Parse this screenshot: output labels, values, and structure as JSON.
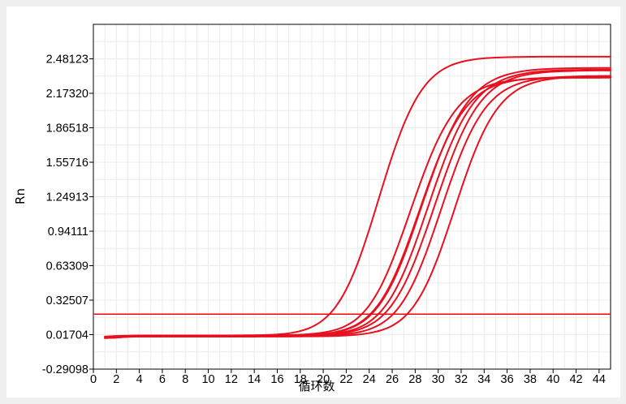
{
  "chart_data": {
    "type": "line",
    "title": "",
    "xlabel": "循环数",
    "ylabel": "Rn",
    "xlim": [
      0,
      45
    ],
    "ylim": [
      -0.29098,
      2.78925
    ],
    "grid": true,
    "legend": "none",
    "x_ticks": [
      0,
      2,
      4,
      6,
      8,
      10,
      12,
      14,
      16,
      18,
      20,
      22,
      24,
      26,
      28,
      30,
      32,
      34,
      36,
      38,
      40,
      42,
      44
    ],
    "x_tick_labels": [
      "0",
      "2",
      "4",
      "6",
      "8",
      "10",
      "12",
      "14",
      "16",
      "18",
      "20",
      "22",
      "24",
      "26",
      "28",
      "30",
      "32",
      "34",
      "36",
      "38",
      "40",
      "42",
      "44"
    ],
    "y_ticks": [
      -0.29098,
      0.01704,
      0.32507,
      0.63309,
      0.94111,
      1.24913,
      1.55716,
      1.86518,
      2.1732,
      2.48123
    ],
    "y_tick_labels": [
      "-0.29098",
      "0.01704",
      "0.32507",
      "0.63309",
      "0.94111",
      "1.24913",
      "1.55716",
      "1.86518",
      "2.17320",
      "2.48123"
    ],
    "x": [
      1,
      2,
      3,
      4,
      5,
      6,
      7,
      8,
      9,
      10,
      11,
      12,
      13,
      14,
      15,
      16,
      17,
      18,
      19,
      20,
      21,
      22,
      23,
      24,
      25,
      26,
      27,
      28,
      29,
      30,
      31,
      32,
      33,
      34,
      35,
      36,
      37,
      38,
      39,
      40,
      41,
      42,
      43,
      44,
      45
    ],
    "series": [
      {
        "values": [
          0.0,
          0.005,
          0.008,
          0.01,
          0.01,
          0.01,
          0.01,
          0.01,
          0.01,
          0.01,
          0.01,
          0.01,
          0.011,
          0.012,
          0.014,
          0.019,
          0.029,
          0.049,
          0.085,
          0.149,
          0.255,
          0.421,
          0.656,
          0.955,
          1.288,
          1.613,
          1.893,
          2.109,
          2.26,
          2.358,
          2.418,
          2.453,
          2.474,
          2.486,
          2.492,
          2.496,
          2.498,
          2.499,
          2.5,
          2.5,
          2.5,
          2.5,
          2.5,
          2.5,
          2.5
        ]
      },
      {
        "values": [
          -0.01,
          -0.006,
          0.005,
          0.007,
          0.007,
          0.007,
          0.007,
          0.007,
          0.007,
          0.007,
          0.008,
          0.008,
          0.008,
          0.009,
          0.01,
          0.011,
          0.013,
          0.017,
          0.024,
          0.036,
          0.058,
          0.098,
          0.166,
          0.278,
          0.446,
          0.675,
          0.951,
          1.245,
          1.524,
          1.763,
          1.947,
          2.08,
          2.168,
          2.225,
          2.26,
          2.281,
          2.294,
          2.302,
          2.306,
          2.309,
          2.311,
          2.312,
          2.312,
          2.312,
          2.313
        ]
      },
      {
        "values": [
          -0.008,
          -0.004,
          0.002,
          0.003,
          0.003,
          0.003,
          0.003,
          0.003,
          0.003,
          0.003,
          0.004,
          0.004,
          0.004,
          0.004,
          0.005,
          0.006,
          0.008,
          0.011,
          0.015,
          0.024,
          0.039,
          0.066,
          0.112,
          0.191,
          0.315,
          0.496,
          0.736,
          1.018,
          1.312,
          1.586,
          1.815,
          1.99,
          2.112,
          2.193,
          2.244,
          2.274,
          2.293,
          2.304,
          2.31,
          2.314,
          2.316,
          2.317,
          2.318,
          2.318,
          2.319
        ]
      },
      {
        "values": [
          -0.014,
          -0.009,
          -0.002,
          0.0,
          0.001,
          0.002,
          0.002,
          0.002,
          0.002,
          0.002,
          0.002,
          0.002,
          0.002,
          0.003,
          0.003,
          0.004,
          0.006,
          0.009,
          0.013,
          0.022,
          0.036,
          0.062,
          0.106,
          0.181,
          0.301,
          0.476,
          0.712,
          0.996,
          1.296,
          1.58,
          1.822,
          2.011,
          2.148,
          2.242,
          2.302,
          2.34,
          2.364,
          2.379,
          2.388,
          2.393,
          2.396,
          2.398,
          2.399,
          2.4,
          2.4
        ]
      },
      {
        "values": [
          -0.012,
          -0.007,
          0.0,
          0.001,
          0.002,
          0.002,
          0.002,
          0.002,
          0.002,
          0.002,
          0.002,
          0.002,
          0.002,
          0.003,
          0.003,
          0.004,
          0.005,
          0.007,
          0.01,
          0.016,
          0.026,
          0.044,
          0.076,
          0.131,
          0.223,
          0.366,
          0.569,
          0.829,
          1.124,
          1.422,
          1.692,
          1.912,
          2.075,
          2.188,
          2.262,
          2.31,
          2.339,
          2.358,
          2.369,
          2.376,
          2.38,
          2.382,
          2.384,
          2.385,
          2.385
        ]
      },
      {
        "values": [
          -0.011,
          -0.006,
          0.001,
          0.002,
          0.002,
          0.002,
          0.002,
          0.002,
          0.002,
          0.002,
          0.002,
          0.002,
          0.002,
          0.003,
          0.003,
          0.004,
          0.005,
          0.006,
          0.009,
          0.013,
          0.021,
          0.035,
          0.059,
          0.101,
          0.172,
          0.286,
          0.455,
          0.684,
          0.962,
          1.262,
          1.551,
          1.8,
          1.995,
          2.134,
          2.227,
          2.286,
          2.322,
          2.344,
          2.358,
          2.366,
          2.371,
          2.374,
          2.376,
          2.377,
          2.377
        ]
      },
      {
        "values": [
          -0.012,
          -0.008,
          -0.001,
          0.0,
          0.0,
          0.0,
          0.0,
          0.001,
          0.001,
          0.001,
          0.001,
          0.001,
          0.001,
          0.001,
          0.002,
          0.002,
          0.003,
          0.004,
          0.006,
          0.008,
          0.013,
          0.022,
          0.037,
          0.065,
          0.112,
          0.192,
          0.322,
          0.512,
          0.763,
          1.058,
          1.361,
          1.637,
          1.861,
          2.027,
          2.14,
          2.213,
          2.259,
          2.287,
          2.304,
          2.314,
          2.32,
          2.324,
          2.326,
          2.327,
          2.328
        ]
      },
      {
        "values": [
          -0.013,
          -0.009,
          -0.003,
          -0.001,
          -0.001,
          -0.001,
          -0.001,
          -0.001,
          -0.001,
          -0.001,
          -0.001,
          -0.001,
          -0.001,
          -0.001,
          0.0,
          0.0,
          0.0,
          0.001,
          0.002,
          0.003,
          0.005,
          0.01,
          0.017,
          0.031,
          0.055,
          0.097,
          0.17,
          0.29,
          0.469,
          0.713,
          1.007,
          1.317,
          1.605,
          1.841,
          2.015,
          2.134,
          2.211,
          2.258,
          2.287,
          2.304,
          2.314,
          2.32,
          2.324,
          2.326,
          2.327
        ]
      }
    ],
    "threshold": {
      "value": 0.2
    }
  }
}
